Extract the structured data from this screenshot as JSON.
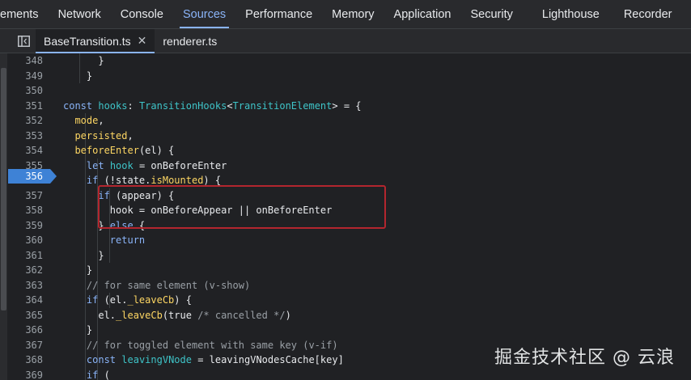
{
  "top_tabs": [
    {
      "label": "ements"
    },
    {
      "label": "Network"
    },
    {
      "label": "Console"
    },
    {
      "label": "Sources",
      "active": true
    },
    {
      "label": "Performance"
    },
    {
      "label": "Memory"
    },
    {
      "label": "Application"
    },
    {
      "label": "Security"
    },
    {
      "label": "Lighthouse"
    },
    {
      "label": "Recorder"
    }
  ],
  "file_tabs": [
    {
      "label": "BaseTransition.ts",
      "active": true,
      "close": "✕"
    },
    {
      "label": "renderer.ts"
    }
  ],
  "breakpoint_line": "356",
  "code_lines": [
    {
      "n": "348",
      "t": "      }"
    },
    {
      "n": "349",
      "t": "    }"
    },
    {
      "n": "350",
      "t": ""
    },
    {
      "n": "351",
      "t": "    const hooks: TransitionHooks<TransitionElement> = {"
    },
    {
      "n": "352",
      "t": "      mode,"
    },
    {
      "n": "353",
      "t": "      persisted,"
    },
    {
      "n": "354",
      "t": "      beforeEnter(el) {"
    },
    {
      "n": "355",
      "t": "        let hook = onBeforeEnter"
    },
    {
      "n": "356",
      "t": "        if (!state.isMounted) {"
    },
    {
      "n": "357",
      "t": "          if (appear) {"
    },
    {
      "n": "358",
      "t": "            hook = onBeforeAppear || onBeforeEnter"
    },
    {
      "n": "359",
      "t": "          } else {"
    },
    {
      "n": "360",
      "t": "            return"
    },
    {
      "n": "361",
      "t": "          }"
    },
    {
      "n": "362",
      "t": "        }"
    },
    {
      "n": "363",
      "t": "        // for same element (v-show)"
    },
    {
      "n": "364",
      "t": "        if (el._leaveCb) {"
    },
    {
      "n": "365",
      "t": "          el._leaveCb(true /* cancelled */)"
    },
    {
      "n": "366",
      "t": "        }"
    },
    {
      "n": "367",
      "t": "        // for toggled element with same key (v-if)"
    },
    {
      "n": "368",
      "t": "        const leavingVNode = leavingVNodesCache[key]"
    },
    {
      "n": "369",
      "t": "        if ("
    }
  ],
  "watermark": "掘金技术社区 @ 云浪",
  "colors": {
    "background": "#202124",
    "accent": "#8ab4f8",
    "breakpoint": "#3e82d6",
    "highlight_box": "#b3262e",
    "keyword": "#8ab4f8",
    "type": "#3ec4c8",
    "property": "#fdd663",
    "comment": "#9aa0a6"
  }
}
